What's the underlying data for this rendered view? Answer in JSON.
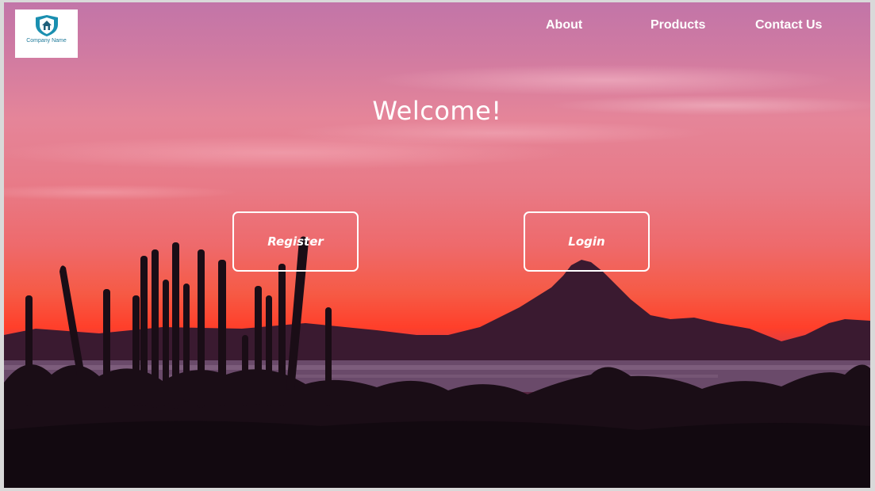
{
  "logo": {
    "company_name": "Company Name",
    "icon": "house-shield-icon"
  },
  "nav": {
    "items": [
      {
        "label": "About"
      },
      {
        "label": "Products"
      },
      {
        "label": "Contact Us"
      }
    ]
  },
  "hero": {
    "heading": "Welcome!",
    "register_label": "Register",
    "login_label": "Login"
  },
  "colors": {
    "sky_top": "#c275a8",
    "sunset": "#ff3f2a",
    "silhouette": "#140a12",
    "text": "#ffffff"
  }
}
